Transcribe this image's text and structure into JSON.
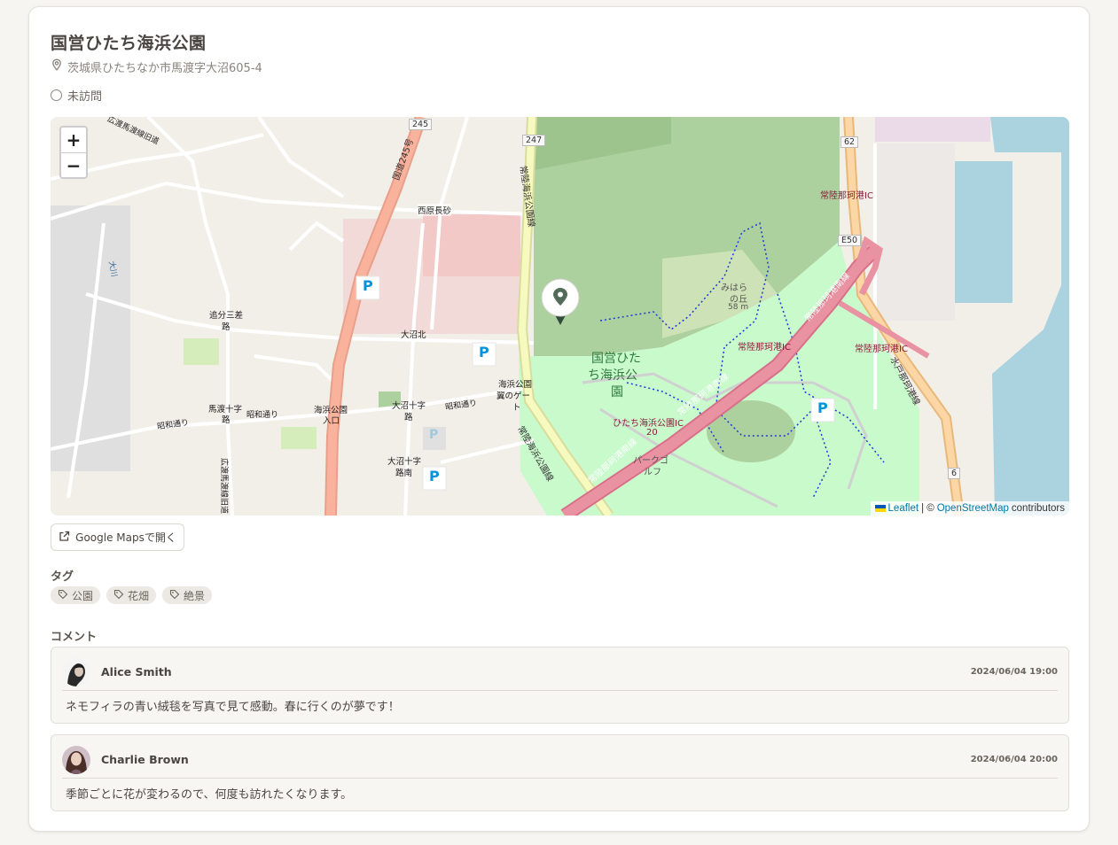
{
  "place": {
    "title": "国営ひたち海浜公園",
    "address": "茨城県ひたちなか市馬渡字大沼605-4",
    "status": "未訪問"
  },
  "map": {
    "zoom_in": "+",
    "zoom_out": "−",
    "attribution": {
      "leaflet": "Leaflet",
      "separator": "| ©",
      "osm": "OpenStreetMap",
      "contributors": "contributors"
    },
    "labels": {
      "park_name_1": "国営ひた",
      "park_name_2": "ち海浜公",
      "park_name_3": "園",
      "road_245": "国道245号",
      "road_247": "常陸海浜公園線",
      "road_247b": "常陸海浜公園線",
      "expressway_1": "常陸那珂港南線",
      "expressway_2": "常陸那珂港南線",
      "expressway_3": "常陸那珂港南線",
      "ic_1": "常陸那珂港IC",
      "ic_2": "常陸那珂港IC",
      "ic_3": "常陸那珂港IC",
      "ic_4": "ひたち海浜公園IC",
      "ic_4_num": "20",
      "mito_road": "水戸那珂港線",
      "hill_1": "みはら",
      "hill_2": "の丘",
      "hill_3": "58 m",
      "nishiharaosuna": "西原長砂",
      "oinuma_kita": "大沼北",
      "oiwake_1": "追分三差",
      "oiwake_2": "路",
      "mawatari_1": "馬渡十字",
      "mawatari_2": "路",
      "showa_1": "昭和通り",
      "showa_2": "昭和通り",
      "showa_3": "昭和通り",
      "kaihin_iriguchi_1": "海浜公園",
      "kaihin_iriguchi_2": "入口",
      "oinuma_cross_1": "大沼十字",
      "oinuma_cross_2": "路",
      "oinuma_south_1": "大沼十字",
      "oinuma_south_2": "路南",
      "tsubasa_1": "海浜公園",
      "tsubasa_2": "翼のゲー",
      "tsubasa_3": "ト",
      "park_golf_1": "パークゴ",
      "park_golf_2": "ルフ",
      "hirowatari": "広渡馬渡線旧道",
      "hirowatari_2": "広渡馬渡線旧道",
      "river": "大川",
      "shield_245": "245",
      "shield_247": "247",
      "shield_62": "62",
      "shield_e50": "E50",
      "shield_6": "6",
      "parking": "P"
    }
  },
  "gmaps_button": {
    "label": "Google Mapsで開く"
  },
  "tags": {
    "heading": "タグ",
    "items": [
      "公園",
      "花畑",
      "絶景"
    ]
  },
  "comments": {
    "heading": "コメント",
    "items": [
      {
        "author": "Alice Smith",
        "date": "2024/06/04 19:00",
        "body": "ネモフィラの青い絨毯を写真で見て感動。春に行くのが夢です！"
      },
      {
        "author": "Charlie Brown",
        "date": "2024/06/04 20:00",
        "body": "季節ごとに花が変わるので、何度も訪れたくなります。"
      }
    ]
  },
  "colors": {
    "background": "#f6f5f2",
    "card": "#ffffff",
    "text": "#4a4540",
    "muted": "#8a847d",
    "park": "#c8facc",
    "forest": "#add19e",
    "water": "#aad3df",
    "motorway": "#e892a2",
    "primary_road": "#f9b29c",
    "secondary_road": "#f7fabf"
  }
}
